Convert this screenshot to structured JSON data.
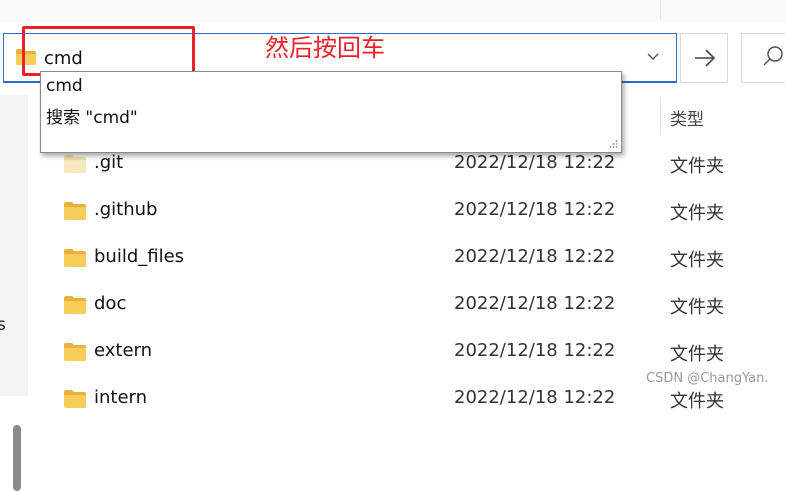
{
  "address_bar": {
    "value": "cmd"
  },
  "annotation": {
    "text": "然后按回车"
  },
  "autocomplete": {
    "items": [
      "cmd",
      "搜索 \"cmd\""
    ]
  },
  "columns": {
    "type_header": "类型"
  },
  "sidebar": {
    "partial_text": "s"
  },
  "files": [
    {
      "name": ".git",
      "date": "2022/12/18 12:22",
      "type": "文件夹"
    },
    {
      "name": ".github",
      "date": "2022/12/18 12:22",
      "type": "文件夹"
    },
    {
      "name": "build_files",
      "date": "2022/12/18 12:22",
      "type": "文件夹"
    },
    {
      "name": "doc",
      "date": "2022/12/18 12:22",
      "type": "文件夹"
    },
    {
      "name": "extern",
      "date": "2022/12/18 12:22",
      "type": "文件夹"
    },
    {
      "name": "intern",
      "date": "2022/12/18 12:22",
      "type": "文件夹"
    }
  ],
  "watermark": "CSDN @ChangYan.",
  "icons": {
    "folder": "folder-icon",
    "chevron": "chevron-down-icon",
    "go": "arrow-right-icon",
    "search": "search-icon",
    "grip": "resize-grip-icon"
  },
  "colors": {
    "accent": "#2a6cc7",
    "annotation": "#e8212a",
    "folder": "#f4c54d"
  }
}
